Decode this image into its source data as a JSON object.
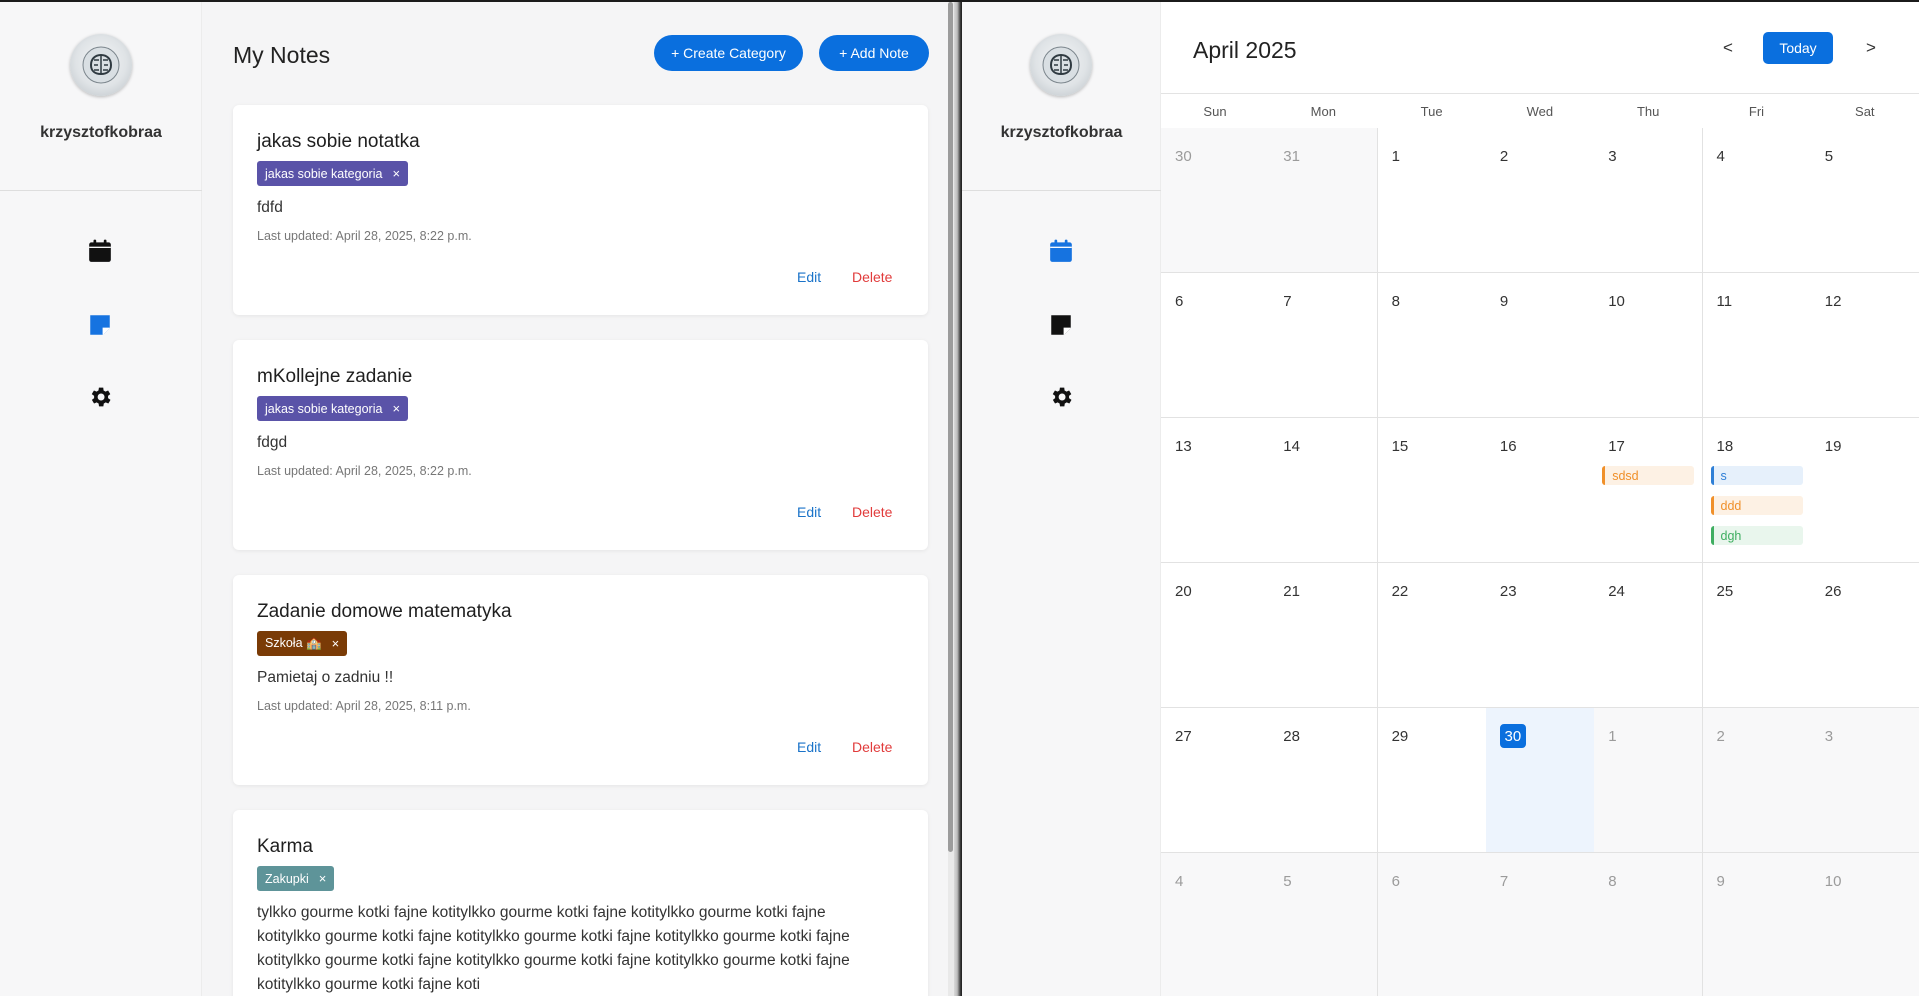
{
  "left_window": {
    "sidebar": {
      "username": "krzysztofkobraa",
      "nav": [
        {
          "name": "calendar-icon"
        },
        {
          "name": "notes-icon"
        },
        {
          "name": "settings-icon"
        }
      ]
    },
    "header": {
      "title": "My Notes",
      "create_category_label": "+ Create Category",
      "add_note_label": "+ Add Note"
    },
    "notes": [
      {
        "title": "jakas sobie notatka",
        "tag": "jakas sobie kategoria",
        "tag_color": "#5a53a8",
        "body": "fdfd",
        "updated": "Last updated: April 28, 2025, 8:22 p.m.",
        "edit": "Edit",
        "delete": "Delete"
      },
      {
        "title": "mKollejne zadanie",
        "tag": "jakas sobie kategoria",
        "tag_color": "#5a53a8",
        "body": "fdgd",
        "updated": "Last updated: April 28, 2025, 8:22 p.m.",
        "edit": "Edit",
        "delete": "Delete"
      },
      {
        "title": "Zadanie domowe matematyka",
        "tag": "Szkoła 🏫",
        "tag_color": "#7a3b06",
        "body": "Pamietaj o zadniu !!",
        "updated": "Last updated: April 28, 2025, 8:11 p.m.",
        "edit": "Edit",
        "delete": "Delete"
      },
      {
        "title": "Karma",
        "tag": "Zakupki",
        "tag_color": "#5e9499",
        "body": "tylkko gourme kotki fajne kotitylkko gourme kotki fajne kotitylkko gourme kotki fajne kotitylkko gourme kotki fajne kotitylkko gourme kotki fajne kotitylkko gourme kotki fajne kotitylkko gourme kotki fajne kotitylkko gourme kotki fajne kotitylkko gourme kotki fajne kotitylkko gourme kotki fajne koti"
      }
    ],
    "tag_remove_symbol": "×"
  },
  "right_window": {
    "sidebar": {
      "username": "krzysztofkobraa",
      "nav": [
        {
          "name": "calendar-icon"
        },
        {
          "name": "notes-icon"
        },
        {
          "name": "settings-icon"
        }
      ]
    },
    "calendar": {
      "title": "April 2025",
      "prev": "<",
      "today": "Today",
      "next": ">",
      "weekdays": [
        "Sun",
        "Mon",
        "Tue",
        "Wed",
        "Thu",
        "Fri",
        "Sat"
      ],
      "weeks": [
        [
          {
            "d": "30",
            "o": true
          },
          {
            "d": "31",
            "o": true
          },
          {
            "d": "1"
          },
          {
            "d": "2"
          },
          {
            "d": "3"
          },
          {
            "d": "4"
          },
          {
            "d": "5"
          }
        ],
        [
          {
            "d": "6"
          },
          {
            "d": "7"
          },
          {
            "d": "8"
          },
          {
            "d": "9"
          },
          {
            "d": "10"
          },
          {
            "d": "11"
          },
          {
            "d": "12"
          }
        ],
        [
          {
            "d": "13"
          },
          {
            "d": "14"
          },
          {
            "d": "15"
          },
          {
            "d": "16"
          },
          {
            "d": "17",
            "events": [
              {
                "t": "sdsd",
                "c": "orange"
              }
            ]
          },
          {
            "d": "18",
            "events": [
              {
                "t": "s",
                "c": "blue"
              },
              {
                "t": "ddd",
                "c": "orange"
              },
              {
                "t": "dgh",
                "c": "green"
              }
            ]
          },
          {
            "d": "19"
          }
        ],
        [
          {
            "d": "20"
          },
          {
            "d": "21"
          },
          {
            "d": "22"
          },
          {
            "d": "23"
          },
          {
            "d": "24"
          },
          {
            "d": "25"
          },
          {
            "d": "26"
          }
        ],
        [
          {
            "d": "27"
          },
          {
            "d": "28"
          },
          {
            "d": "29"
          },
          {
            "d": "30",
            "today": true
          },
          {
            "d": "1",
            "o": true
          },
          {
            "d": "2",
            "o": true
          },
          {
            "d": "3",
            "o": true
          }
        ],
        [
          {
            "d": "4",
            "o": true
          },
          {
            "d": "5",
            "o": true
          },
          {
            "d": "6",
            "o": true
          },
          {
            "d": "7",
            "o": true
          },
          {
            "d": "8",
            "o": true
          },
          {
            "d": "9",
            "o": true
          },
          {
            "d": "10",
            "o": true
          }
        ]
      ]
    }
  },
  "colors": {
    "accent": "#0a6fde",
    "danger": "#e13b3b",
    "link": "#1a73c9",
    "event_orange": "#f0902a",
    "event_blue": "#2f7fd6",
    "event_green": "#3fae61"
  }
}
